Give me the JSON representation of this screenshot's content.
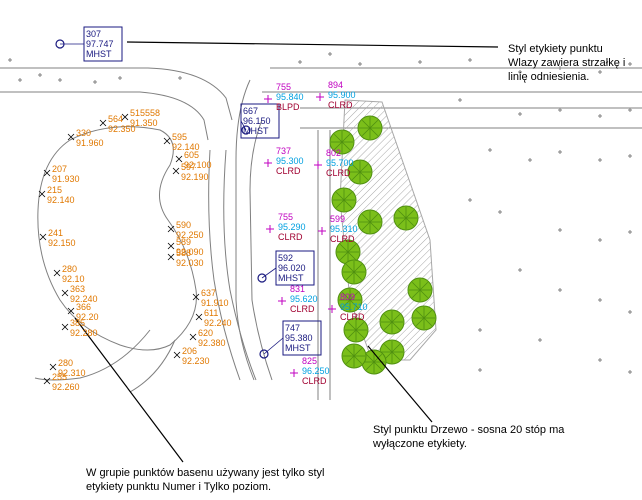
{
  "callouts": {
    "label_style": {
      "lines": [
        "Styl etykiety punktu",
        "Wlazy zawiera strzałkę i",
        "linię odniesienia."
      ]
    },
    "tree_style": {
      "lines": [
        "Styl punktu Drzewo - sosna 20 stóp ma",
        "wyłączone etykiety."
      ]
    },
    "basin_group": {
      "lines": [
        "W grupie punktów basenu używany jest tylko styl",
        "etykiety punktu Numer i Tylko poziom."
      ]
    }
  },
  "colors": {
    "orange": "#e07800",
    "magenta": "#c000c0",
    "blue_label": "#00a0e0",
    "navy": "#1a1a80",
    "dark_red": "#a00030",
    "tree_green": "#7bbf1a",
    "hatch_gray": "#a8a8a8",
    "line_gray": "#808080"
  },
  "orange_labels": [
    {
      "id": "lbl-564",
      "num": "564",
      "elev": "92.350"
    },
    {
      "id": "lbl-515558",
      "num": "515558",
      "elev": "91.350"
    },
    {
      "id": "lbl-330",
      "num": "330",
      "elev": "91.960"
    },
    {
      "id": "lbl-595",
      "num": "595",
      "elev": "92.140"
    },
    {
      "id": "lbl-597",
      "num": "597",
      "elev": "92.190"
    },
    {
      "id": "lbl-605",
      "num": "605",
      "elev": "92.100"
    },
    {
      "id": "lbl-207",
      "num": "207",
      "elev": "91.930"
    },
    {
      "id": "lbl-215",
      "num": "215",
      "elev": "92.140"
    },
    {
      "id": "lbl-241",
      "num": "241",
      "elev": "92.150"
    },
    {
      "id": "lbl-590",
      "num": "590",
      "elev": "92.250"
    },
    {
      "id": "lbl-589",
      "num": "589",
      "elev": "92.090"
    },
    {
      "id": "lbl-588",
      "num": "588",
      "elev": "92.030"
    },
    {
      "id": "lbl-280a",
      "num": "280",
      "elev": "92.10"
    },
    {
      "id": "lbl-363",
      "num": "363",
      "elev": "92.240"
    },
    {
      "id": "lbl-366",
      "num": "366",
      "elev": "92.20"
    },
    {
      "id": "lbl-385",
      "num": "385",
      "elev": "92.280"
    },
    {
      "id": "lbl-637",
      "num": "637",
      "elev": "91.910"
    },
    {
      "id": "lbl-611",
      "num": "611",
      "elev": "92.240"
    },
    {
      "id": "lbl-620",
      "num": "620",
      "elev": "92.380"
    },
    {
      "id": "lbl-206",
      "num": "206",
      "elev": "92.230"
    },
    {
      "id": "lbl-280b",
      "num": "280",
      "elev": "92.310"
    },
    {
      "id": "lbl-255",
      "num": "255",
      "elev": "92.260"
    }
  ],
  "survey_labels": [
    {
      "id": "svy-755a",
      "num": "755",
      "elev": "95.840",
      "code": "BLPD"
    },
    {
      "id": "svy-894",
      "num": "894",
      "elev": "95.900",
      "code": "CLRD"
    },
    {
      "id": "svy-737",
      "num": "737",
      "elev": "95.300",
      "code": "CLRD"
    },
    {
      "id": "svy-802",
      "num": "802",
      "elev": "95.700",
      "code": "CLRD"
    },
    {
      "id": "svy-755b",
      "num": "755",
      "elev": "95.290",
      "code": "CLRD"
    },
    {
      "id": "svy-599",
      "num": "599",
      "elev": "95.310",
      "code": "CLRD"
    },
    {
      "id": "svy-831",
      "num": "831",
      "elev": "95.620",
      "code": "CLRD"
    },
    {
      "id": "svy-809",
      "num": "809",
      "elev": "95.710",
      "code": "CLRD"
    },
    {
      "id": "svy-825",
      "num": "825",
      "elev": "96.250",
      "code": "CLRD"
    }
  ],
  "manholes": [
    {
      "id": "mh-307",
      "num": "307",
      "elev": "97.747",
      "code": "MHST"
    },
    {
      "id": "mh-667",
      "num": "667",
      "elev": "96.150",
      "code": "MHST"
    },
    {
      "id": "mh-592",
      "num": "592",
      "elev": "96.020",
      "code": "MHST"
    },
    {
      "id": "mh-747",
      "num": "747",
      "elev": "95.380",
      "code": "MHST"
    }
  ]
}
